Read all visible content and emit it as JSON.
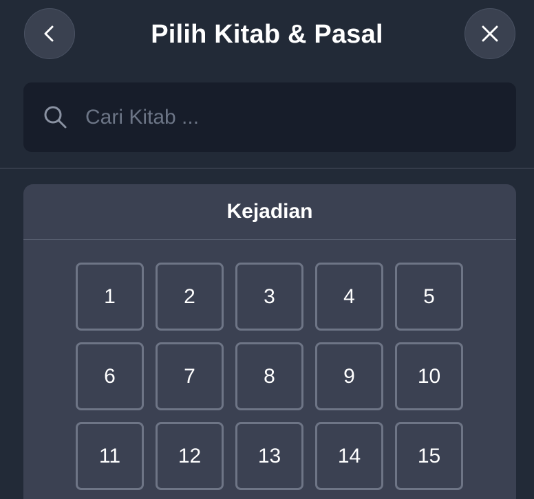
{
  "header": {
    "title": "Pilih Kitab & Pasal",
    "back_icon": "chevron-left-icon",
    "close_icon": "close-icon"
  },
  "search": {
    "placeholder": "Cari Kitab ...",
    "value": "",
    "icon": "search-icon"
  },
  "book": {
    "name": "Kejadian",
    "chapters": [
      "1",
      "2",
      "3",
      "4",
      "5",
      "6",
      "7",
      "8",
      "9",
      "10",
      "11",
      "12",
      "13",
      "14",
      "15"
    ]
  },
  "colors": {
    "background": "#222a37",
    "search_bg": "#171d2a",
    "card_bg": "#3b4152",
    "button_border": "#6e7586",
    "placeholder": "#6c7586"
  }
}
